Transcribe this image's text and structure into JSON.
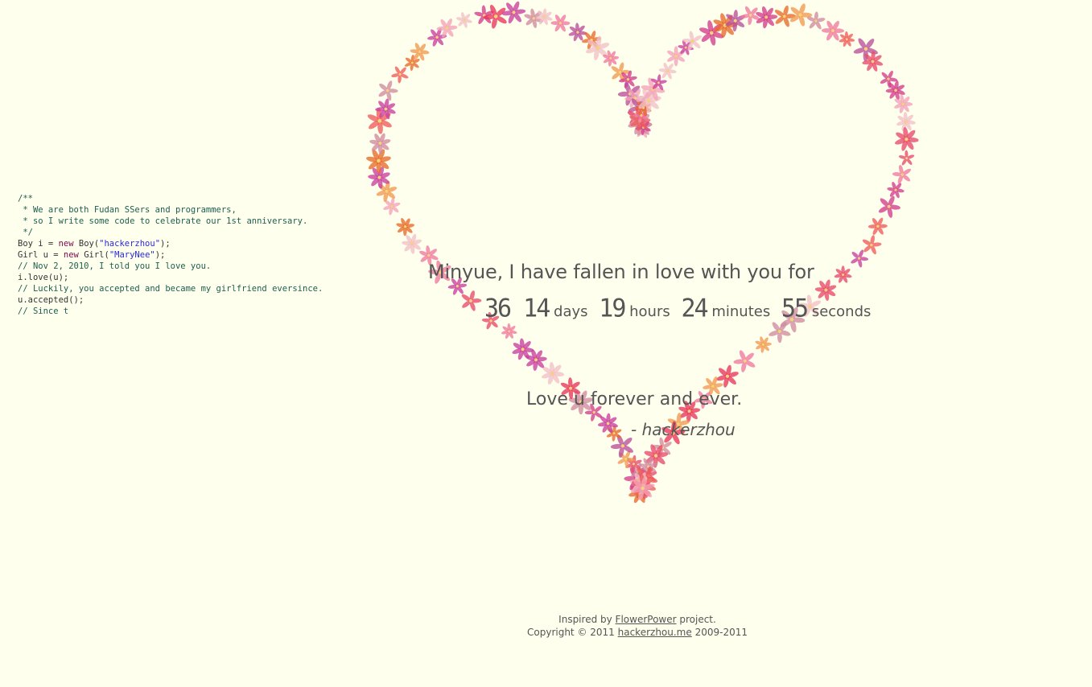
{
  "code": {
    "lines": [
      [
        {
          "t": "/**",
          "c": "comments"
        }
      ],
      [
        {
          "t": " * We are both Fudan SSers and programmers,",
          "c": "comments"
        }
      ],
      [
        {
          "t": " * so I write some code to celebrate our 1st anniversary.",
          "c": "comments"
        }
      ],
      [
        {
          "t": " */",
          "c": "comments"
        }
      ],
      [
        {
          "t": "Boy i = ",
          "c": ""
        },
        {
          "t": "new",
          "c": "keyword"
        },
        {
          "t": " Boy(",
          "c": ""
        },
        {
          "t": "\"hackerzhou\"",
          "c": "string"
        },
        {
          "t": ");",
          "c": ""
        }
      ],
      [
        {
          "t": "Girl u = ",
          "c": ""
        },
        {
          "t": "new",
          "c": "keyword"
        },
        {
          "t": " Girl(",
          "c": ""
        },
        {
          "t": "\"MaryNee\"",
          "c": "string"
        },
        {
          "t": ");",
          "c": ""
        }
      ],
      [
        {
          "t": "// Nov 2, 2010, I told you I love you.",
          "c": "comments"
        }
      ],
      [
        {
          "t": "i.love(u);",
          "c": ""
        }
      ],
      [
        {
          "t": "// Luckily, you accepted and became my girlfriend eversince.",
          "c": "comments"
        }
      ],
      [
        {
          "t": "u.accepted();",
          "c": ""
        }
      ],
      [
        {
          "t": "// Since t",
          "c": "comments"
        }
      ]
    ]
  },
  "message": {
    "title": "Minyue, I have fallen in love with you for",
    "days_value": "36 14",
    "days_label": "days",
    "hours_value": "19",
    "hours_label": "hours",
    "minutes_value": "24",
    "minutes_label": "minutes",
    "seconds_value": "55",
    "seconds_label": "seconds"
  },
  "words": {
    "line": "Love u forever and ever.",
    "signature": "- hackerzhou"
  },
  "footer": {
    "inspired_prefix": "Inspired by ",
    "inspired_link": "FlowerPower",
    "inspired_suffix": " project.",
    "copyright_prefix": "Copyright © 2011 ",
    "copyright_link": "hackerzhou.me",
    "copyright_suffix": " 2009-2011"
  },
  "colors": {
    "background": "#ffffee",
    "text": "#555555",
    "code_comment": "#1e5e4e",
    "code_keyword": "#7a0b4c",
    "code_string": "#2a2ad6",
    "flower_palette": [
      "#e8365a",
      "#f07aa0",
      "#d43c8a",
      "#f4a3b8",
      "#e86a2a",
      "#c93f9e",
      "#ef5b5b",
      "#b8509a",
      "#f2c0c8",
      "#e84a6a",
      "#f09a50",
      "#d08aa0"
    ]
  },
  "icons": {
    "flower": "flower-icon"
  }
}
